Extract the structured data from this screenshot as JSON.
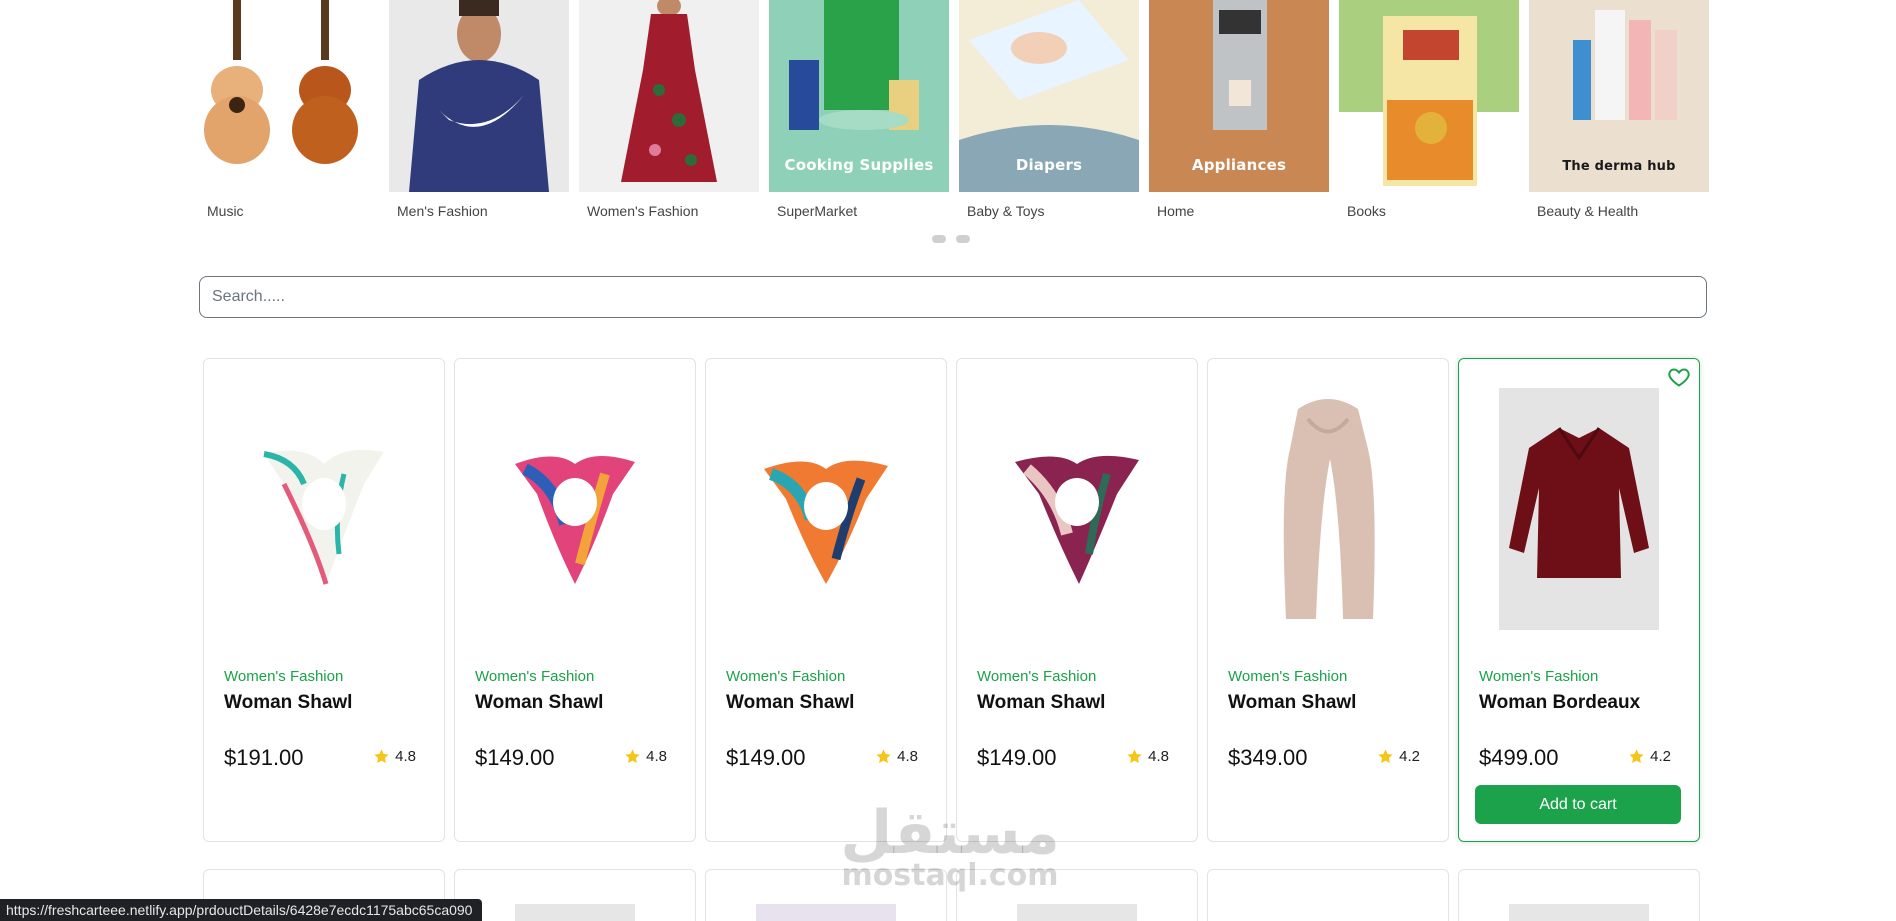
{
  "categories": [
    {
      "label": "Music",
      "caption": ""
    },
    {
      "label": "Men's Fashion",
      "caption": ""
    },
    {
      "label": "Women's Fashion",
      "caption": ""
    },
    {
      "label": "SuperMarket",
      "caption": "Cooking Supplies"
    },
    {
      "label": "Baby & Toys",
      "caption": "Diapers"
    },
    {
      "label": "Home",
      "caption": "Appliances"
    },
    {
      "label": "Books",
      "caption": ""
    },
    {
      "label": "Beauty & Health",
      "caption": "The derma hub"
    }
  ],
  "search": {
    "placeholder": "Search....."
  },
  "products": [
    {
      "category": "Women's Fashion",
      "title": "Woman Shawl",
      "price": "$191.00",
      "rating": "4.8"
    },
    {
      "category": "Women's Fashion",
      "title": "Woman Shawl",
      "price": "$149.00",
      "rating": "4.8"
    },
    {
      "category": "Women's Fashion",
      "title": "Woman Shawl",
      "price": "$149.00",
      "rating": "4.8"
    },
    {
      "category": "Women's Fashion",
      "title": "Woman Shawl",
      "price": "$149.00",
      "rating": "4.8"
    },
    {
      "category": "Women's Fashion",
      "title": "Woman Shawl",
      "price": "$349.00",
      "rating": "4.2"
    },
    {
      "category": "Women's Fashion",
      "title": "Woman Bordeaux",
      "price": "$499.00",
      "rating": "4.2",
      "add_to_cart": "Add to cart"
    }
  ],
  "watermark": {
    "arabic": "مستقل",
    "latin": "mostaql.com"
  },
  "status_url": "https://freshcarteee.netlify.app/prdouctDetails/6428e7ecdc1175abc65ca090",
  "colors": {
    "accent": "#1ba24a",
    "star": "#f5c518"
  }
}
